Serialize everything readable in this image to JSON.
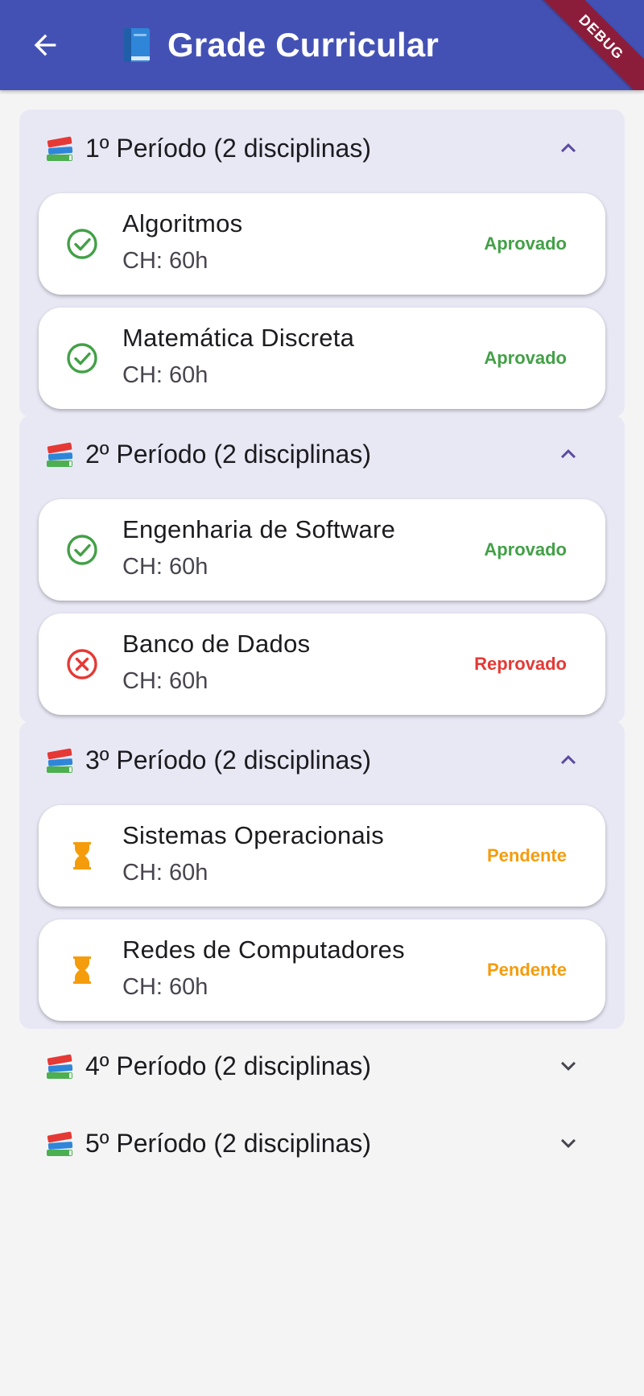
{
  "appbar": {
    "title": "Grade Curricular",
    "title_icon": "blue-book-icon",
    "back_icon": "arrow-back-icon",
    "color": "#4451b4",
    "debug_label": "DEBUG"
  },
  "colors": {
    "approved": "#43a047",
    "failed": "#e53935",
    "pending": "#f59c0c",
    "accent": "#5b4ba0"
  },
  "periods": [
    {
      "label": "1º Período (2 disciplinas)",
      "expanded": true,
      "disciplines": [
        {
          "name": "Algoritmos",
          "ch": "CH: 60h",
          "status": "Aprovado",
          "icon": "check-circle-icon"
        },
        {
          "name": "Matemática Discreta",
          "ch": "CH: 60h",
          "status": "Aprovado",
          "icon": "check-circle-icon"
        }
      ]
    },
    {
      "label": "2º Período (2 disciplinas)",
      "expanded": true,
      "disciplines": [
        {
          "name": "Engenharia de Software",
          "ch": "CH: 60h",
          "status": "Aprovado",
          "icon": "check-circle-icon"
        },
        {
          "name": "Banco de Dados",
          "ch": "CH: 60h",
          "status": "Reprovado",
          "icon": "cancel-circle-icon"
        }
      ]
    },
    {
      "label": "3º Período (2 disciplinas)",
      "expanded": true,
      "disciplines": [
        {
          "name": "Sistemas Operacionais",
          "ch": "CH: 60h",
          "status": "Pendente",
          "icon": "hourglass-icon"
        },
        {
          "name": "Redes de Computadores",
          "ch": "CH: 60h",
          "status": "Pendente",
          "icon": "hourglass-icon"
        }
      ]
    },
    {
      "label": "4º Período (2 disciplinas)",
      "expanded": false,
      "disciplines": []
    },
    {
      "label": "5º Período (2 disciplinas)",
      "expanded": false,
      "disciplines": []
    }
  ]
}
